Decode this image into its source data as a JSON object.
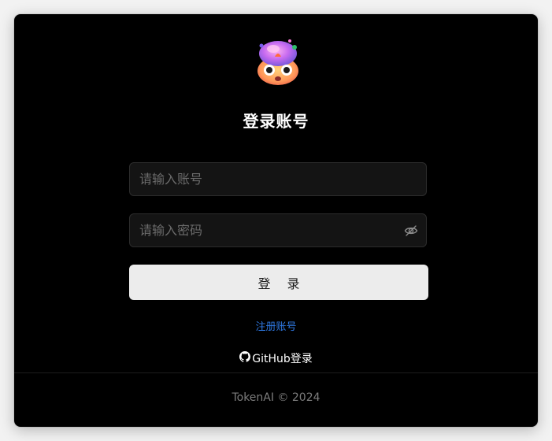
{
  "logo": {
    "icon": "mind-blown-emoji-icon"
  },
  "title": "登录账号",
  "form": {
    "account_placeholder": "请输入账号",
    "account_value": "",
    "password_placeholder": "请输入密码",
    "password_value": "",
    "password_toggle_icon": "eye-off-icon",
    "login_label": "登 录"
  },
  "links": {
    "register": "注册账号",
    "github_login": "GitHub登录",
    "github_icon": "github-icon"
  },
  "footer": {
    "copyright": "TokenAI © 2024"
  },
  "colors": {
    "background": "#000000",
    "input_bg": "#141414",
    "button_bg": "#ececec",
    "link": "#2f7ae5",
    "footer_text": "#7d7d7d"
  }
}
